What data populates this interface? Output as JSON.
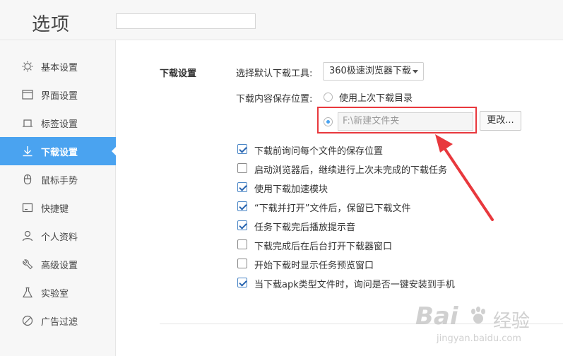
{
  "header": {
    "title": "选项"
  },
  "sidebar": {
    "items": [
      {
        "label": "基本设置",
        "icon": "sun-icon"
      },
      {
        "label": "界面设置",
        "icon": "window-icon"
      },
      {
        "label": "标签设置",
        "icon": "tab-icon"
      },
      {
        "label": "下载设置",
        "icon": "download-icon",
        "active": true
      },
      {
        "label": "鼠标手势",
        "icon": "mouse-icon"
      },
      {
        "label": "快捷键",
        "icon": "keyboard-icon"
      },
      {
        "label": "个人资料",
        "icon": "user-icon"
      },
      {
        "label": "高级设置",
        "icon": "wrench-icon"
      },
      {
        "label": "实验室",
        "icon": "flask-icon"
      },
      {
        "label": "广告过滤",
        "icon": "block-icon"
      }
    ]
  },
  "download": {
    "section_title": "下载设置",
    "default_tool_label": "选择默认下载工具:",
    "default_tool_value": "360极速浏览器下载",
    "save_location_label": "下载内容保存位置:",
    "use_last_dir_label": "使用上次下载目录",
    "custom_path_value": "F:\\新建文件夹",
    "change_button": "更改...",
    "options": [
      {
        "label": "下载前询问每个文件的保存位置",
        "checked": true
      },
      {
        "label": "启动浏览器后，继续进行上次未完成的下载任务",
        "checked": false
      },
      {
        "label": "使用下载加速模块",
        "checked": true
      },
      {
        "label": "“下载并打开”文件后，保留已下载文件",
        "checked": true
      },
      {
        "label": "任务下载完后播放提示音",
        "checked": true
      },
      {
        "label": "下载完成后在后台打开下载器窗口",
        "checked": false
      },
      {
        "label": "开始下载时显示任务预览窗口",
        "checked": false
      },
      {
        "label": "当下载apk类型文件时，询问是否一键安装到手机",
        "checked": true
      }
    ]
  },
  "watermark": {
    "brand": "Bai",
    "brand2": "经验",
    "url": "jingyan.baidu.com"
  },
  "colors": {
    "accent": "#4aa3f0",
    "highlight": "#e8383d"
  }
}
